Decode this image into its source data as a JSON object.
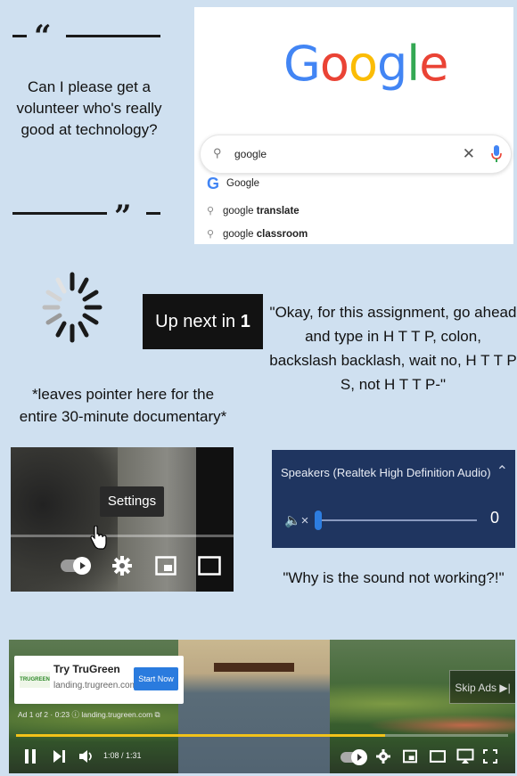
{
  "quote": {
    "open_mark": "“",
    "close_mark": "”",
    "text": "Can I please get a volunteer who's really good at technology?"
  },
  "google": {
    "logo_letters": [
      {
        "ch": "G",
        "color": "#4285F4"
      },
      {
        "ch": "o",
        "color": "#EA4335"
      },
      {
        "ch": "o",
        "color": "#FBBC05"
      },
      {
        "ch": "g",
        "color": "#4285F4"
      },
      {
        "ch": "l",
        "color": "#34A853"
      },
      {
        "ch": "e",
        "color": "#EA4335"
      }
    ],
    "search_value": "google",
    "suggestions": [
      {
        "prefix": "Google",
        "bold": ""
      },
      {
        "prefix": "google ",
        "bold": "translate"
      },
      {
        "prefix": "google ",
        "bold": "classroom"
      }
    ]
  },
  "up_next": {
    "label": "Up next in ",
    "count": "1"
  },
  "caption_pointer": "*leaves pointer here for the entire 30-minute documentary*",
  "caption_http": "\"Okay, for this assignment, go ahead and type in H T T P, colon, backslash backlash, wait no,  H T T P S, not H T T P-\"",
  "settings_video": {
    "tooltip": "Settings"
  },
  "volume_panel": {
    "title": "Speakers (Realtek High Definition Audio)",
    "level": 0,
    "level_label": "0"
  },
  "caption_sound": "\"Why is the sound not working?!\"",
  "ad_video": {
    "ad_title": "Try TruGreen",
    "ad_url": "landing.trugreen.com",
    "ad_button": "Start Now",
    "ad_logo": "TRUGREEN",
    "ad_info": "Ad 1 of 2 · 0:23 ⓘ  landing.trugreen.com ⧉",
    "skip_label": "Skip Ads ▶|",
    "time": "1:08 / 1:31",
    "progress": 0.75,
    "progress_color": "#f2c21a"
  }
}
